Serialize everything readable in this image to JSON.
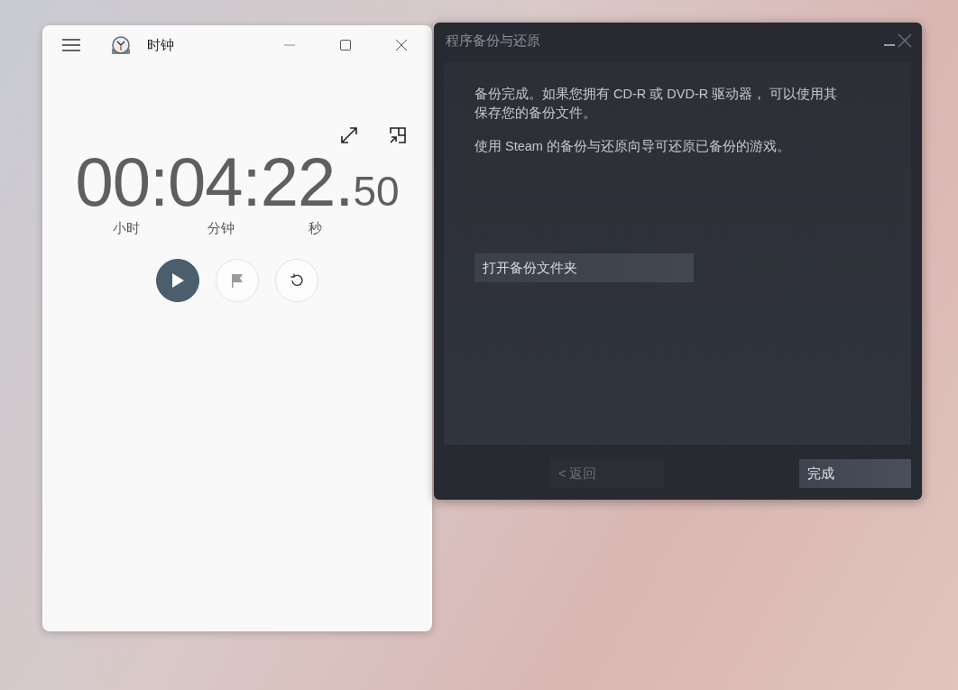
{
  "clock_window": {
    "title": "时钟",
    "time": {
      "main": "00:04:22.",
      "fraction": "50"
    },
    "units": [
      "小时",
      "分钟",
      "秒"
    ],
    "controls": [
      {
        "kind": "play",
        "disabled": false
      },
      {
        "kind": "flag",
        "disabled": true
      },
      {
        "kind": "reset",
        "disabled": false
      }
    ]
  },
  "backup_window": {
    "title": "程序备份与还原",
    "paragraphs": [
      "备份完成。如果您拥有 CD-R 或 DVD-R 驱动器， 可以使用其保存您的备份文件。",
      "使用 Steam 的备份与还原向导可还原已备份的游戏。"
    ],
    "open_folder_button": "打开备份文件夹",
    "buttons": [
      {
        "label": "< 返回",
        "disabled": true
      },
      {
        "label": "完成",
        "disabled": false
      }
    ]
  }
}
